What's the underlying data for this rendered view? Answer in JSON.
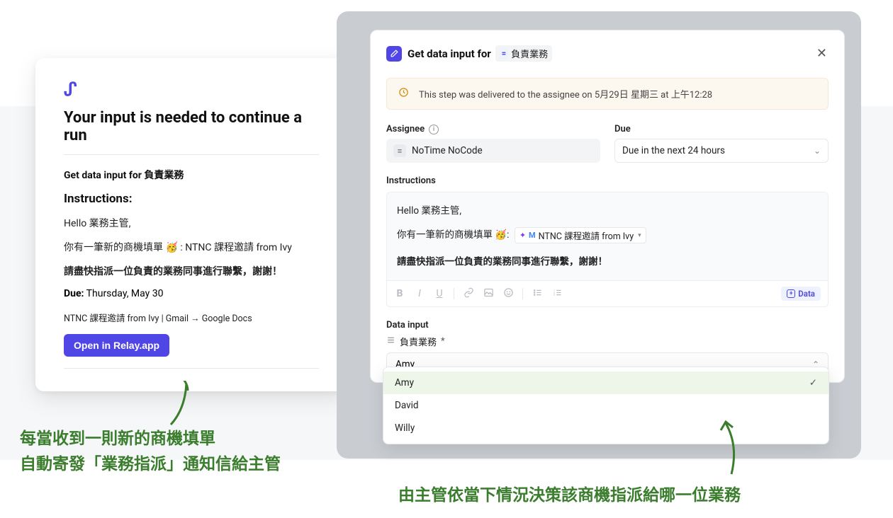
{
  "colors": {
    "accent": "#4f46e5",
    "annotation": "#3a7d2d",
    "alert_bg": "#fdf8ef"
  },
  "left": {
    "logo_char": "ᔑ",
    "title": "Your input is needed to continue a run",
    "subtitle": "Get data input for 負責業務",
    "instructions_heading": "Instructions:",
    "greeting": "Hello 業務主管,",
    "body_prefix": "你有一筆新的商機填單 ",
    "emoji": "🥳",
    "body_suffix": " : NTNC 課程邀請 from Ivy",
    "bold_line": "請盡快指派一位負責的業務同事進行聯繫，謝謝！",
    "due_label": "Due:",
    "due_value": "Thursday, May 30",
    "meta": "NTNC 課程邀請 from Ivy | Gmail → Google Docs",
    "open_button": "Open in Relay.app"
  },
  "annotations": {
    "left_line1": "每當收到一則新的商機填單",
    "left_line2": "自動寄發「業務指派」通知信給主管",
    "right": "由主管依當下情況決策該商機指派給哪一位業務"
  },
  "right": {
    "header_prefix": "Get data input for",
    "header_chip": "負責業務",
    "alert": "This step was delivered to the assignee on 5月29日 星期三 at 上午12:28",
    "assignee_label": "Assignee",
    "assignee_value": "NoTime NoCode",
    "due_label": "Due",
    "due_value": "Due in the next 24 hours",
    "instructions_label": "Instructions",
    "instr_greeting": "Hello 業務主管,",
    "instr_prefix": "你有一筆新的商機填單 ",
    "instr_emoji": "🥳",
    "instr_chip": "NTNC 課程邀請 from Ivy",
    "instr_chip_suffix": ":",
    "instr_bold": "請盡快指派一位負責的業務同事進行聯繫，謝謝！",
    "data_button": "Data",
    "data_input_label": "Data input",
    "field_name": "負責業務",
    "field_required": "*",
    "select_value": "Amy",
    "options": [
      "Amy",
      "David",
      "Willy"
    ],
    "selected_index": 0
  }
}
